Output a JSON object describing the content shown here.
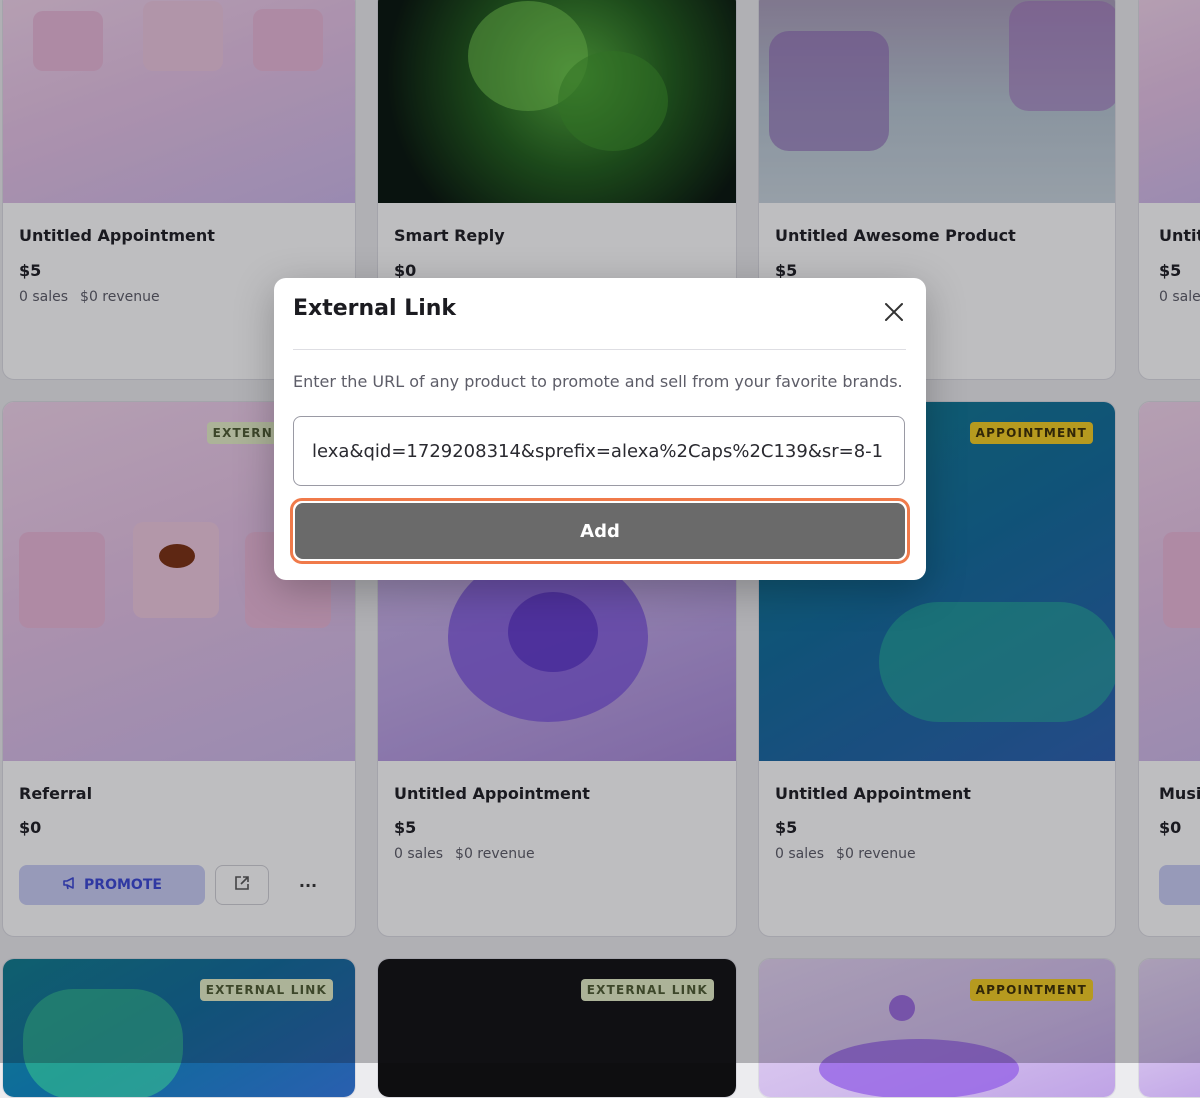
{
  "cards": [
    {
      "title": "Untitled Appointment",
      "price": "$5",
      "sales": "0 sales",
      "revenue": "$0 revenue"
    },
    {
      "title": "Smart Reply",
      "price": "$0"
    },
    {
      "title": "Untitled Awesome Product",
      "price": "$5"
    },
    {
      "title": "Untit",
      "price": "$5",
      "sales": "0 sale"
    },
    {
      "title": "Referral",
      "price": "$0",
      "badge": "EXTERN",
      "promote_label": "PROMOTE"
    },
    {
      "title": "Untitled Appointment",
      "price": "$5",
      "sales": "0 sales",
      "revenue": "$0 revenue"
    },
    {
      "title": "Untitled Appointment",
      "price": "$5",
      "sales": "0 sales",
      "revenue": "$0 revenue",
      "badge": "APPOINTMENT"
    },
    {
      "title": "Musi",
      "price": "$0"
    },
    {
      "badge": "EXTERNAL LINK"
    },
    {
      "badge": "EXTERNAL LINK"
    },
    {
      "badge": "APPOINTMENT"
    }
  ],
  "modal": {
    "title": "External Link",
    "description": "Enter the URL of any product to promote and sell from your favorite brands.",
    "url_value": "lexa&qid=1729208314&sprefix=alexa%2Caps%2C139&sr=8-1",
    "add_label": "Add"
  },
  "colors": {
    "accent_outline": "#f07a4a",
    "add_button": "#6a6a6a",
    "promote_bg": "#c9cef6",
    "promote_text": "#3a46d6",
    "badge_external": "#e6f0c8",
    "badge_appointment": "#f4cd20"
  },
  "icons": {
    "close": "close-icon",
    "megaphone": "megaphone-icon",
    "external": "external-link-icon",
    "more": "more-icon"
  }
}
